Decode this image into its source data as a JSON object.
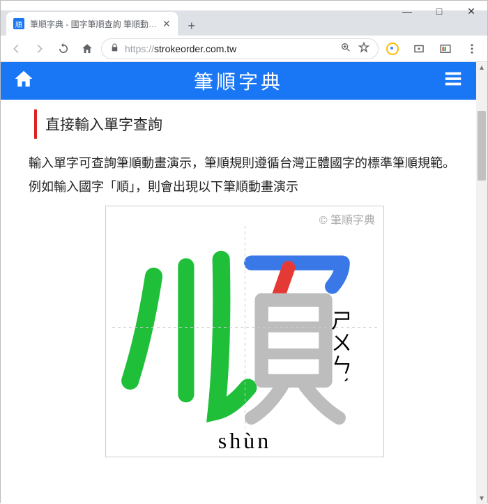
{
  "window": {
    "minimize": "—",
    "maximize": "□",
    "close": "✕"
  },
  "tab": {
    "favicon_text": "順",
    "title": "筆順字典 - 國字筆順查詢 筆順動…",
    "close": "✕",
    "new": "+"
  },
  "toolbar": {
    "url_scheme": "https://",
    "url_host": "strokeorder.com.tw"
  },
  "site": {
    "title": "筆順字典"
  },
  "section": {
    "heading": "直接輸入單字查詢",
    "description": "輸入單字可查詢筆順動畫演示，筆順規則遵循台灣正體國字的標準筆順規範。例如輸入國字「順」，則會出現以下筆順動畫演示"
  },
  "card": {
    "watermark": "© 筆順字典",
    "zhuyin": "ㄕㄨㄣˋ",
    "pinyin": "shùn"
  },
  "chart_data": {
    "type": "glyph-stroke-order",
    "character": "順",
    "zhuyin": "ㄕㄨㄣˋ",
    "pinyin": "shùn",
    "strokes_colors_visible": [
      "green",
      "green",
      "green",
      "blue",
      "red"
    ],
    "remaining_strokes_color": "gray"
  }
}
